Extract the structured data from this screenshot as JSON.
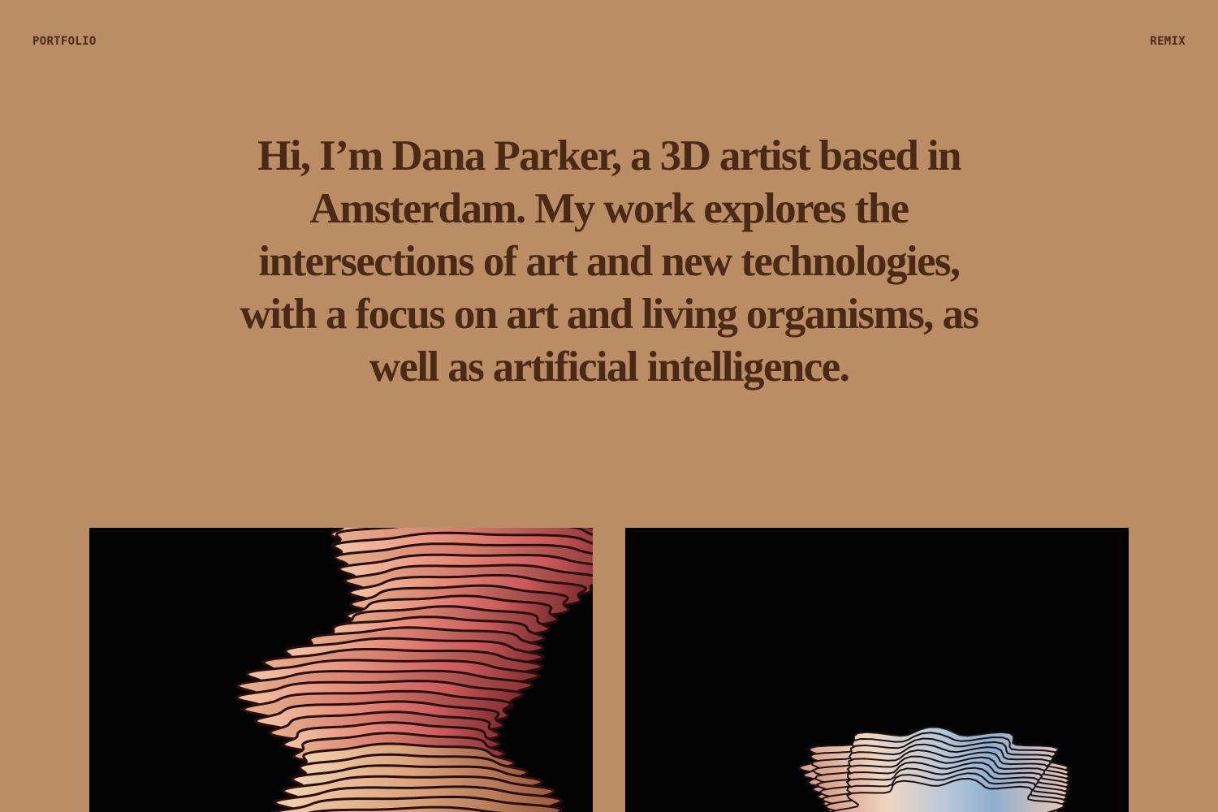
{
  "header": {
    "portfolio_label": "PORTFOLIO",
    "remix_label": "REMIX"
  },
  "intro": {
    "text": "Hi, I’m Dana Parker, a 3D artist based in Amsterdam. My work explores the intersections of art and new technologies, with a focus on art and living organisms, as well as artificial intelligence."
  },
  "colors": {
    "background": "#BA8D65",
    "text": "#4A2A16",
    "artwork_background": "#040303"
  },
  "gallery": {
    "items": [
      {
        "name": "artwork-coral-spiral"
      },
      {
        "name": "artwork-pastel-ripple"
      }
    ]
  }
}
